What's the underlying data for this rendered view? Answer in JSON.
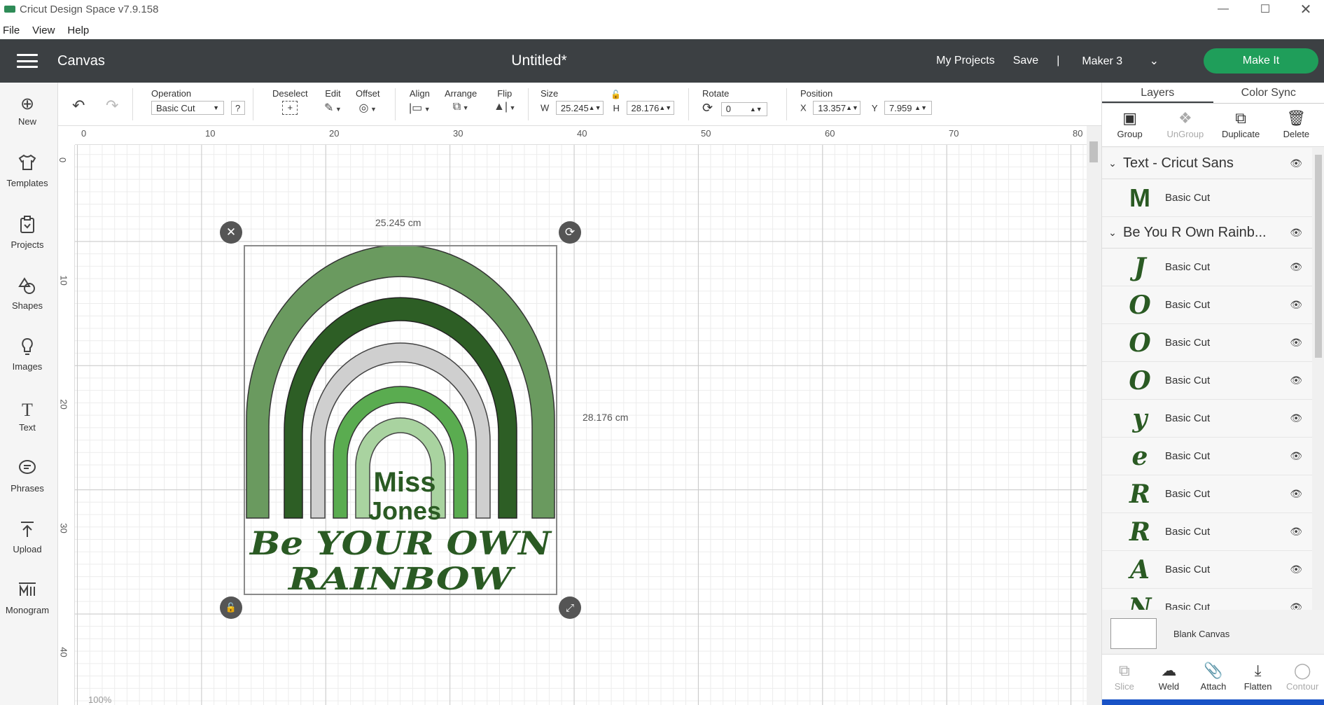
{
  "window": {
    "title": "Cricut Design Space  v7.9.158",
    "logo_text": "cricut"
  },
  "menu": [
    "File",
    "View",
    "Help"
  ],
  "topbar": {
    "section": "Canvas",
    "doc_title": "Untitled*",
    "my_projects": "My Projects",
    "save": "Save",
    "separator": "|",
    "machine": "Maker 3",
    "make_it": "Make It",
    "accent_color": "#1f9e5a"
  },
  "leftnav": [
    {
      "label": "New",
      "icon": "plus-circle-icon"
    },
    {
      "label": "Templates",
      "icon": "shirt-icon"
    },
    {
      "label": "Projects",
      "icon": "projects-icon"
    },
    {
      "label": "Shapes",
      "icon": "shapes-icon"
    },
    {
      "label": "Images",
      "icon": "lightbulb-icon"
    },
    {
      "label": "Text",
      "icon": "text-icon"
    },
    {
      "label": "Phrases",
      "icon": "speech-bubble-icon"
    },
    {
      "label": "Upload",
      "icon": "upload-icon"
    },
    {
      "label": "Monogram",
      "icon": "monogram-icon"
    }
  ],
  "toolbar": {
    "operation_label": "Operation",
    "operation_value": "Basic Cut",
    "help": "?",
    "deselect": "Deselect",
    "edit": "Edit",
    "offset": "Offset",
    "align": "Align",
    "arrange": "Arrange",
    "flip": "Flip",
    "size_label": "Size",
    "w_label": "W",
    "w_value": "25.245",
    "h_label": "H",
    "h_value": "28.176",
    "rotate_label": "Rotate",
    "rotate_value": "0",
    "position_label": "Position",
    "x_label": "X",
    "x_value": "13.357",
    "y_label": "Y",
    "y_value": "7.959"
  },
  "ruler": {
    "top": [
      "0",
      "10",
      "20",
      "30",
      "40",
      "50",
      "60",
      "70",
      "80"
    ],
    "left": [
      "0",
      "10",
      "20",
      "30",
      "40"
    ]
  },
  "canvas": {
    "width_label": "25.245 cm",
    "height_label": "28.176 cm",
    "name_text_1": "Miss",
    "name_text_2": "Jones",
    "phrase_1": "Be YOUR OWN",
    "phrase_2": "RAINBOW",
    "arc_colors": [
      "#6a9a5f",
      "#2d5e25",
      "#cfcfcf",
      "#5aac50",
      "#a9d3a0"
    ],
    "text_color": "#2a5a23",
    "zoom": "100%"
  },
  "panel": {
    "tabs": [
      "Layers",
      "Color Sync"
    ],
    "actions": [
      {
        "label": "Group",
        "icon": "group-icon",
        "enabled": true
      },
      {
        "label": "UnGroup",
        "icon": "ungroup-icon",
        "enabled": false
      },
      {
        "label": "Duplicate",
        "icon": "duplicate-icon",
        "enabled": true
      },
      {
        "label": "Delete",
        "icon": "trash-icon",
        "enabled": true
      }
    ],
    "group1": {
      "title": "Text - Cricut Sans",
      "items": [
        {
          "glyph": "M",
          "name": "Basic Cut"
        }
      ]
    },
    "group2": {
      "title": "Be You R Own Rainb...",
      "items": [
        {
          "glyph": "J",
          "name": "Basic Cut"
        },
        {
          "glyph": "O",
          "name": "Basic Cut"
        },
        {
          "glyph": "O",
          "name": "Basic Cut"
        },
        {
          "glyph": "O",
          "name": "Basic Cut"
        },
        {
          "glyph": "y",
          "name": "Basic Cut"
        },
        {
          "glyph": "e",
          "name": "Basic Cut"
        },
        {
          "glyph": "R",
          "name": "Basic Cut"
        },
        {
          "glyph": "R",
          "name": "Basic Cut"
        },
        {
          "glyph": "A",
          "name": "Basic Cut"
        },
        {
          "glyph": "N",
          "name": "Basic Cut"
        }
      ]
    },
    "blank_canvas": "Blank Canvas",
    "bottom": [
      {
        "label": "Slice",
        "icon": "slice-icon",
        "enabled": false
      },
      {
        "label": "Weld",
        "icon": "weld-icon",
        "enabled": true
      },
      {
        "label": "Attach",
        "icon": "attach-icon",
        "enabled": true
      },
      {
        "label": "Flatten",
        "icon": "flatten-icon",
        "enabled": true
      },
      {
        "label": "Contour",
        "icon": "contour-icon",
        "enabled": false
      }
    ]
  }
}
